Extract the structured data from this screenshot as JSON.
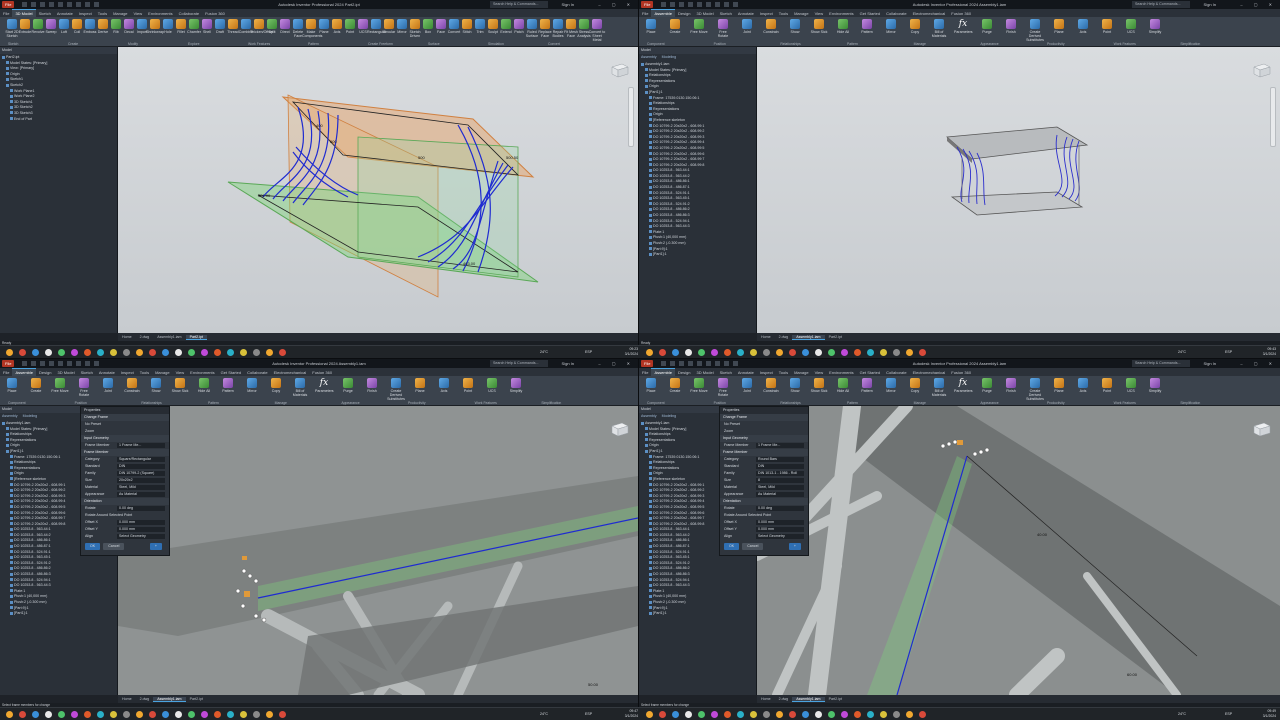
{
  "panes": {
    "tl": {
      "title": "Autodesk Inventor Professional 2024   Part2.ipt",
      "tabs": [
        "File",
        "3D Model",
        "Sketch",
        "Annotate",
        "Inspect",
        "Tools",
        "Manage",
        "View",
        "Environments",
        "Collaborate",
        "Fusion 360"
      ],
      "ribbon": [
        "Start 2D Sketch",
        "Extrude",
        "Revolve",
        "Sweep",
        "Loft",
        "Coil",
        "Emboss",
        "Derive",
        "Rib",
        "Decal",
        "Import",
        "Shrinkwrap",
        "Hole",
        "Fillet",
        "Chamfer",
        "Shell",
        "Draft",
        "Thread",
        "Combine",
        "Thicken/Offset",
        "Split",
        "Direct",
        "Delete Face",
        "Make Components",
        "Plane",
        "Axis",
        "Point",
        "UCS",
        "Rectangular",
        "Circular",
        "Mirror",
        "Sketch Driven",
        "Box",
        "Face",
        "Convert",
        "Stitch",
        "Trim",
        "Sculpt",
        "Extend",
        "Patch",
        "Ruled Surface",
        "Replace Face",
        "Repair Bodies",
        "Fit Mesh Face",
        "Stress Analysis",
        "Convert to Sheet Metal"
      ],
      "groups": [
        "Sketch",
        "Create",
        "Modify",
        "Explore",
        "Work Features",
        "Pattern",
        "Create Freeform",
        "Surface",
        "Simulation",
        "Convert"
      ],
      "browser_head": "Model",
      "tree": [
        "Part2.ipt",
        "Model States: [Primary]",
        "View: [Primary]",
        "Origin",
        "Sketch1",
        "Sketch2",
        "Work Plane1",
        "Work Plane2",
        "3D Sketch1",
        "3D Sketch2",
        "3D Sketch3",
        "End of Part"
      ],
      "doctabs": [
        "Home",
        "2.dwg",
        "Assembly1.iam",
        "Part2.ipt"
      ],
      "status": "Ready"
    },
    "tr": {
      "title": "Autodesk Inventor Professional 2024   Assembly1.iam",
      "tabs": [
        "File",
        "Assemble",
        "Design",
        "3D Model",
        "Sketch",
        "Annotate",
        "Inspect",
        "Tools",
        "Manage",
        "View",
        "Environments",
        "Get Started",
        "Collaborate",
        "Electromechanical",
        "Fusion 360"
      ],
      "ribbon": [
        "Place",
        "Create",
        "Free Move",
        "Free Rotate",
        "Joint",
        "Constrain",
        "Show",
        "Show Sick",
        "Hide All",
        "Pattern",
        "Mirror",
        "Copy",
        "Bill of Materials",
        "Parameters",
        "Purge",
        "Finish",
        "Create Derived Substitutes",
        "Plane",
        "Axis",
        "Point",
        "UCS",
        "Simplify"
      ],
      "groups": [
        "Component",
        "Position",
        "Relationships",
        "Pattern",
        "Manage",
        "Appearance",
        "Productivity",
        "Work Features",
        "Simplification"
      ],
      "browser_head": "Model",
      "browser_tabs": [
        "Assembly",
        "Modeling"
      ],
      "tree": [
        "Assembly1.iam",
        "Model States: [Primary]",
        "Relationships",
        "Representations",
        "Origin",
        "[Part1]:1",
        "Frame: 17539.0130.150.06:1",
        "Relationships",
        "Representations",
        "Origin",
        "[Reference skeleton",
        "DO 10799-2 20x20x2 - 608.99:1",
        "DO 10799-2 20x20x2 - 608.99:2",
        "DO 10799-2 20x20x2 - 608.99:3",
        "DO 10799-2 20x20x2 - 608.99:4",
        "DO 10799-2 20x20x2 - 608.99:5",
        "DO 10799-2 20x20x2 - 608.99:6",
        "DO 10799-2 20x20x2 - 608.99:7",
        "DO 10799-2 20x20x2 - 608.99:8",
        "DO 10253.8 - 563.44:1",
        "DO 10253.8 - 563.44:2",
        "DO 10253.8 - 486.86:1",
        "DO 10253.8 - 486.87:1",
        "DO 10253.8 - 524.91:1",
        "DO 10253.8 - 563.45:1",
        "DO 10253.8 - 524.91:2",
        "DO 10253.8 - 486.86:2",
        "DO 10253.8 - 486.86:3",
        "DO 10253.8 - 524.94:1",
        "DO 10253.8 - 563.44:3",
        "Plate:1",
        "Plush:1 (40,000 mm)",
        "Plush:2 (-0.300 mm)",
        "[Part:9]:1",
        "[Part1]:1"
      ],
      "doctabs": [
        "Home",
        "2.dwg",
        "Assembly1.iam",
        "Part2.ipt"
      ],
      "status": "Ready"
    },
    "bl": {
      "title": "Autodesk Inventor Professional 2024   Assembly1.iam",
      "tabs": [
        "File",
        "Assemble",
        "Design",
        "3D Model",
        "Sketch",
        "Annotate",
        "Inspect",
        "Tools",
        "Manage",
        "View",
        "Environments",
        "Get Started",
        "Collaborate",
        "Electromechanical",
        "Fusion 360"
      ],
      "ribbon": [
        "Place",
        "Create",
        "Free Move",
        "Free Rotate",
        "Joint",
        "Constrain",
        "Show",
        "Show Sick",
        "Hide All",
        "Pattern",
        "Mirror",
        "Copy",
        "Bill of Materials",
        "Parameters",
        "Purge",
        "Finish",
        "Create Derived Substitutes",
        "Plane",
        "Axis",
        "Point",
        "UCS",
        "Simplify"
      ],
      "groups": [
        "Component",
        "Position",
        "Relationships",
        "Pattern",
        "Manage",
        "Appearance",
        "Productivity",
        "Work Features",
        "Simplification"
      ],
      "browser_head": "Model",
      "browser_tabs": [
        "Assembly",
        "Modeling"
      ],
      "tree": [
        "Assembly1.iam",
        "Model States: [Primary]",
        "Relationships",
        "Representations",
        "Origin",
        "[Part1]:1",
        "Frame: 17539.0130.150.06:1",
        "Relationships",
        "Representations",
        "Origin",
        "[Reference skeleton",
        "DO 10799-2 20x20x2 - 608.99:1",
        "DO 10799-2 20x20x2 - 608.99:2",
        "DO 10799-2 20x20x2 - 608.99:3",
        "DO 10799-2 20x20x2 - 608.99:4",
        "DO 10799-2 20x20x2 - 608.99:5",
        "DO 10799-2 20x20x2 - 608.99:6",
        "DO 10799-2 20x20x2 - 608.99:7",
        "DO 10799-2 20x20x2 - 608.99:8",
        "DO 10253.8 - 563.44:1",
        "DO 10253.8 - 563.44:2",
        "DO 10253.8 - 486.86:1",
        "DO 10253.8 - 486.87:1",
        "DO 10253.8 - 524.91:1",
        "DO 10253.8 - 563.45:1",
        "DO 10253.8 - 524.91:2",
        "DO 10253.8 - 486.86:2",
        "DO 10253.8 - 486.86:3",
        "DO 10253.8 - 524.94:1",
        "DO 10253.8 - 563.44:3",
        "Plate:1",
        "Plush:1 (40,000 mm)",
        "Plush:2 (-0.300 mm)",
        "[Part:9]:1",
        "[Part1]:1"
      ],
      "doctabs": [
        "Home",
        "2.dwg",
        "Assembly1.iam",
        "Part2.ipt"
      ],
      "status": "Select frame members for change",
      "props": {
        "header": "Properties",
        "title": "Change Frame",
        "preset": "No Preset",
        "zoom": "Zoom",
        "sec_input": "Input Geometry",
        "frame_member_label": "Frame Member",
        "frame_member_value": "1 Frame Me...",
        "sec_frame": "Frame Member",
        "category_label": "Category",
        "category_value": "Square/Rectangular",
        "standard_label": "Standard",
        "standard_value": "DIN",
        "family_label": "Family",
        "family_value": "DIN 10799-2 (Square)",
        "size_label": "Size",
        "size_value": "20x20x2",
        "material_label": "Material",
        "material_value": "Steel, Mild",
        "appearance_label": "Appearance",
        "appearance_value": "As Material",
        "sec_orient": "Orientation",
        "rotate_label": "Rotate",
        "rotate_value": "0.00 deg",
        "rotate_check": "Rotate Around Selected Point",
        "offsetx_label": "Offset X",
        "offsetx_value": "0.000 mm",
        "offsety_label": "Offset Y",
        "offsety_value": "0.000 mm",
        "align_label": "Align",
        "align_value": "Select Geometry",
        "ok": "OK",
        "cancel": "Cancel",
        "plus": "+"
      }
    },
    "br": {
      "title": "Autodesk Inventor Professional 2024   Assembly1.iam",
      "tabs": [
        "File",
        "Assemble",
        "Design",
        "3D Model",
        "Sketch",
        "Annotate",
        "Inspect",
        "Tools",
        "Manage",
        "View",
        "Environments",
        "Get Started",
        "Collaborate",
        "Electromechanical",
        "Fusion 360"
      ],
      "ribbon": [
        "Place",
        "Create",
        "Free Move",
        "Free Rotate",
        "Joint",
        "Constrain",
        "Show",
        "Show Sick",
        "Hide All",
        "Pattern",
        "Mirror",
        "Copy",
        "Bill of Materials",
        "Parameters",
        "Purge",
        "Finish",
        "Create Derived Substitutes",
        "Plane",
        "Axis",
        "Point",
        "UCS",
        "Simplify"
      ],
      "groups": [
        "Component",
        "Position",
        "Relationships",
        "Pattern",
        "Manage",
        "Appearance",
        "Productivity",
        "Work Features",
        "Simplification"
      ],
      "browser_head": "Model",
      "browser_tabs": [
        "Assembly",
        "Modeling"
      ],
      "tree": [
        "Assembly1.iam",
        "Model States: [Primary]",
        "Relationships",
        "Representations",
        "Origin",
        "[Part1]:1",
        "Frame: 17539.0130.150.06:1",
        "Relationships",
        "Representations",
        "Origin",
        "[Reference skeleton",
        "DO 10799-2 20x20x2 - 608.99:1",
        "DO 10799-2 20x20x2 - 608.99:2",
        "DO 10799-2 20x20x2 - 608.99:3",
        "DO 10799-2 20x20x2 - 608.99:4",
        "DO 10799-2 20x20x2 - 608.99:5",
        "DO 10799-2 20x20x2 - 608.99:6",
        "DO 10799-2 20x20x2 - 608.99:7",
        "DO 10799-2 20x20x2 - 608.99:8",
        "DO 10253.8 - 563.44:1",
        "DO 10253.8 - 563.44:2",
        "DO 10253.8 - 486.86:1",
        "DO 10253.8 - 486.87:1",
        "DO 10253.8 - 524.91:1",
        "DO 10253.8 - 563.45:1",
        "DO 10253.8 - 524.91:2",
        "DO 10253.8 - 486.86:2",
        "DO 10253.8 - 486.86:3",
        "DO 10253.8 - 524.94:1",
        "DO 10253.8 - 563.44:3",
        "Plate:1",
        "Plush:1 (40,000 mm)",
        "Plush:2 (-0.300 mm)",
        "[Part:9]:1",
        "[Part1]:1"
      ],
      "doctabs": [
        "Home",
        "2.dwg",
        "Assembly1.iam",
        "Part2.ipt"
      ],
      "status": "Select frame members for change",
      "props": {
        "header": "Properties",
        "title": "Change Frame",
        "preset": "No Preset",
        "zoom": "Zoom",
        "sec_input": "Input Geometry",
        "frame_member_label": "Frame Member",
        "frame_member_value": "1 Frame Me...",
        "sec_frame": "Frame Member",
        "category_label": "Category",
        "category_value": "Round Bars",
        "standard_label": "Standard",
        "standard_value": "DIN",
        "family_label": "Family",
        "family_value": "DIN 1013-1 - 1986 - Roll",
        "size_label": "Size",
        "size_value": "8",
        "material_label": "Material",
        "material_value": "Steel, Mild",
        "appearance_label": "Appearance",
        "appearance_value": "As Material",
        "sec_orient": "Orientation",
        "rotate_label": "Rotate",
        "rotate_value": "0.00 deg",
        "rotate_check": "Rotate Around Selected Point",
        "offsetx_label": "Offset X",
        "offsetx_value": "0.000 mm",
        "offsety_label": "Offset Y",
        "offsety_value": "0.000 mm",
        "align_label": "Align",
        "align_value": "Select Geometry",
        "ok": "OK",
        "cancel": "Cancel",
        "plus": "+"
      }
    }
  },
  "common": {
    "search": "Search Help & Commands...",
    "sign_in": "Sign In",
    "window_controls": "– ▢ ✕"
  },
  "taskbars": {
    "top": {
      "weather": "24°C",
      "lang": "ESP",
      "time": "09:23",
      "date": "3/1/2024",
      "time2": "09:43",
      "date2": "3/1/2024"
    },
    "bottom": {
      "weather": "24°C",
      "lang": "ESP",
      "time": "09:47",
      "date": "3/1/2024",
      "time2": "09:49",
      "date2": "3/1/2024"
    }
  },
  "dim_labels": {
    "tl": [
      "400",
      "600",
      "500.50",
      "500",
      "566.00",
      "463.00"
    ],
    "br": [
      "40.00",
      "60.00"
    ],
    "bl": [
      "50.00"
    ]
  },
  "colors": {
    "accent": "#4aa3df",
    "file_tab": "#b13523",
    "sketch_blue": "#1f2bd1",
    "plane_green": "#7fd47a",
    "plane_orange": "#e8a060"
  }
}
